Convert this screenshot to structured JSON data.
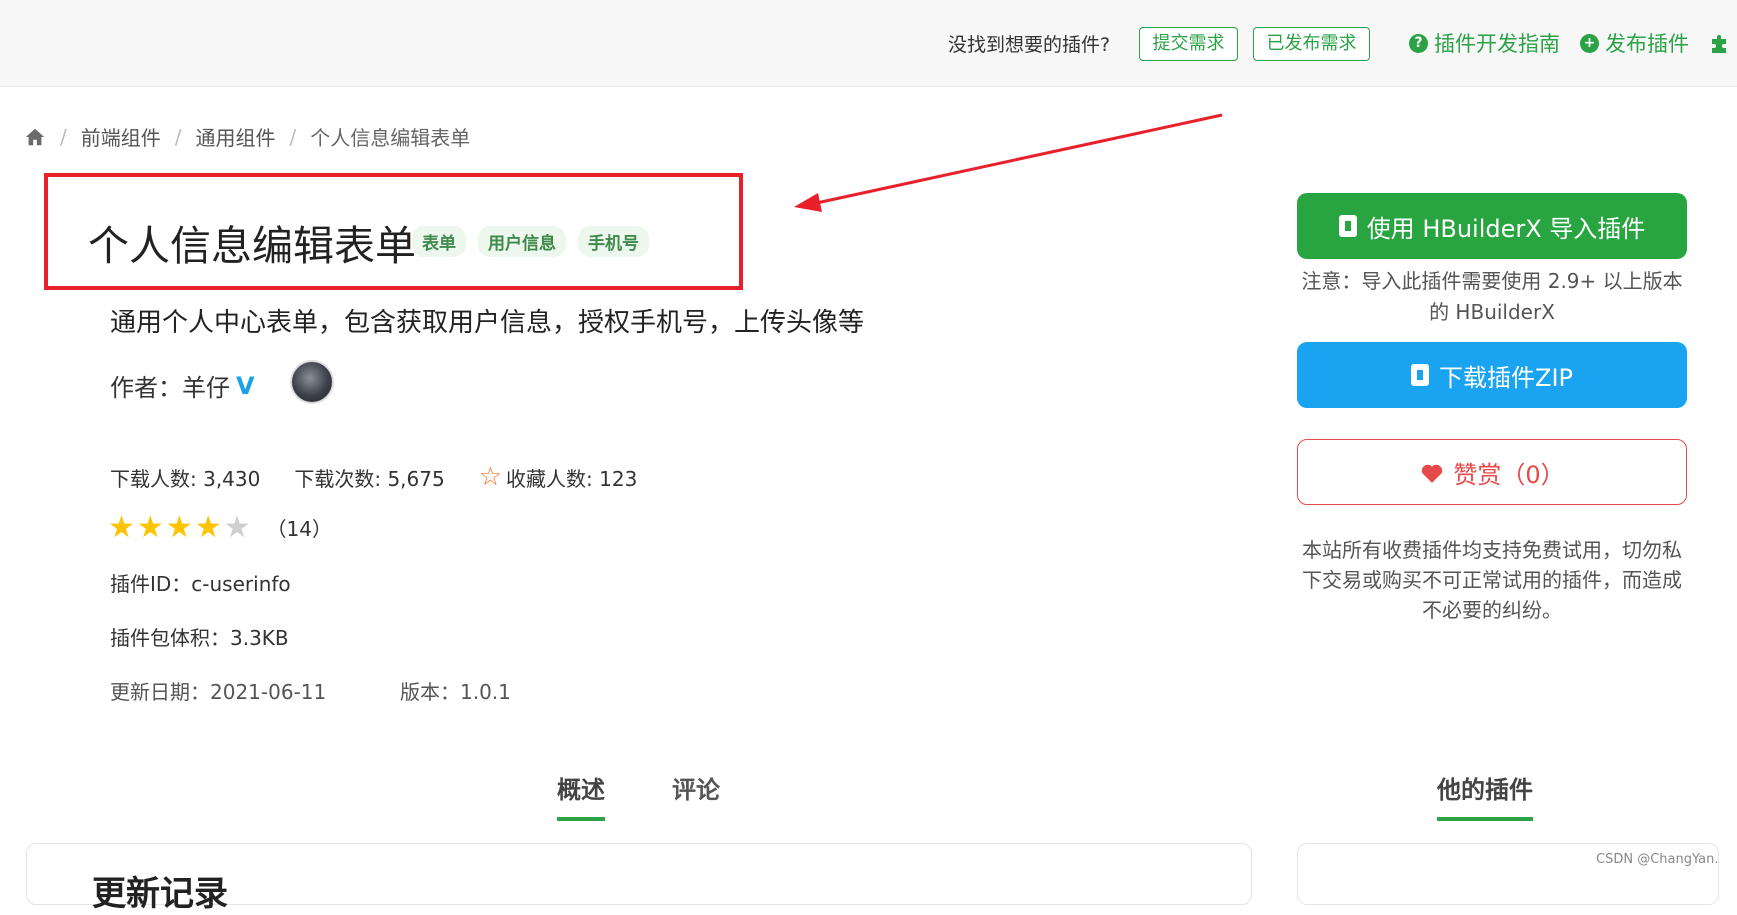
{
  "topbar": {
    "ask_text": "没找到想要的插件?",
    "submit_request": "提交需求",
    "published_requests": "已发布需求",
    "dev_guide": "插件开发指南",
    "publish_plugin": "发布插件"
  },
  "breadcrumb": {
    "items": [
      "前端组件",
      "通用组件",
      "个人信息编辑表单"
    ]
  },
  "plugin": {
    "title": "个人信息编辑表单",
    "tags": [
      "表单",
      "用户信息",
      "手机号"
    ],
    "description": "通用个人中心表单，包含获取用户信息，授权手机号，上传头像等",
    "author_label": "作者：",
    "author_name": "羊仔",
    "verified_mark": "V",
    "downloads_people": "下载人数: 3,430",
    "downloads_times": "下载次数: 5,675",
    "favorites": "收藏人数: 123",
    "rating_stars": 4,
    "rating_max": 5,
    "rating_count": "（14）",
    "plugin_id": "插件ID：c-userinfo",
    "size": "插件包体积：3.3KB",
    "update_date": "更新日期：2021-06-11",
    "version": "版本：1.0.1"
  },
  "tabs": [
    "概述",
    "评论"
  ],
  "side_tab": "他的插件",
  "panel_title": "更新记录",
  "sidebar": {
    "import_button": "使用 HBuilderX 导入插件",
    "import_note": "注意：导入此插件需要使用 2.9+ 以上版本的 HBuilderX",
    "download_button": "下载插件ZIP",
    "reward_button": "赞赏（0）",
    "notice": "本站所有收费插件均支持免费试用，切勿私下交易或购买不可正常试用的插件，而造成不必要的纠纷。"
  },
  "watermark": "CSDN @ChangYan.",
  "colors": {
    "green": "#28a540",
    "blue": "#1aa3f0",
    "red": "#e64a4a",
    "annotation": "#e8202a"
  }
}
